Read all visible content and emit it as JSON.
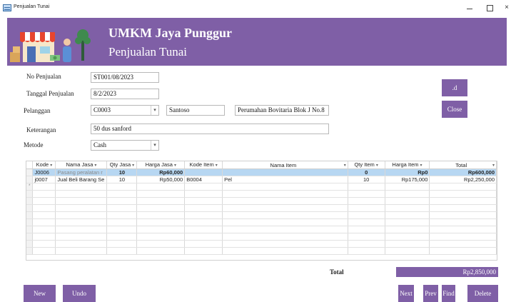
{
  "window": {
    "title": "Penjualan Tunai",
    "close_glyph": "×"
  },
  "header": {
    "title": "UMKM Jaya Punggur",
    "subtitle": "Penjualan Tunai"
  },
  "form": {
    "no_penjualan": {
      "label": "No Penjualan",
      "value": "ST001/08/2023"
    },
    "tanggal": {
      "label": "Tanggal Penjualan",
      "value": "8/2/2023"
    },
    "pelanggan": {
      "label": "Pelanggan",
      "code": "C0003",
      "name": "Santoso",
      "address": "Perumahan Bovitaria Blok J No.8"
    },
    "keterangan": {
      "label": "Keterangan",
      "value": "50 dus sanford"
    },
    "metode": {
      "label": "Metode",
      "value": "Cash"
    }
  },
  "side_buttons": {
    "small_label": ".d",
    "close_label": "Close"
  },
  "table": {
    "columns": [
      "Kode",
      "Nama Jasa",
      "Qty Jasa",
      "Harga Jasa",
      "Kode Item",
      "Nama Item",
      "Qty Item",
      "Harga Item",
      "Total"
    ],
    "rows": [
      {
        "kode": "J0006",
        "nama_jasa": "Pasang peralatan r",
        "qty_jasa": "10",
        "harga_jasa": "Rp60,000",
        "kode_item": "",
        "nama_item": "",
        "qty_item": "0",
        "harga_item": "Rp0",
        "total": "Rp600,000"
      },
      {
        "kode": "j0007",
        "nama_jasa": "Jual Beli Barang Se",
        "qty_jasa": "10",
        "harga_jasa": "Rp50,000",
        "kode_item": "B0004",
        "nama_item": "Pel",
        "qty_item": "10",
        "harga_item": "Rp175,000",
        "total": "Rp2,250,000"
      }
    ],
    "new_row_marker": "*"
  },
  "footer": {
    "total_label": "Total",
    "total_value": "Rp2,850,000",
    "buttons": {
      "new": "New",
      "undo": "Undo",
      "next": "Next",
      "prev": "Prev",
      "find": "Find",
      "delete": "Delete"
    }
  },
  "colors": {
    "accent": "#7f5fa6",
    "selected_row": "#b7d7f2"
  },
  "icons": {
    "dropdown": "chevron-down-icon",
    "sort": "sort-arrow-icon"
  }
}
